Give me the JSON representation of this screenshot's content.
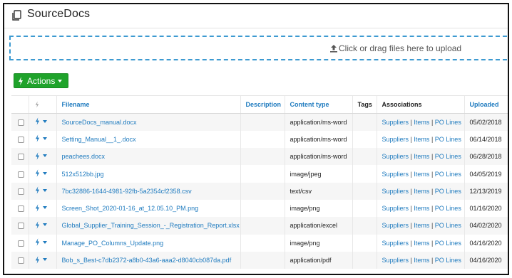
{
  "app": {
    "title": "SourceDocs"
  },
  "upload": {
    "text": "Click or drag files here to upload"
  },
  "actions": {
    "label": "Actions"
  },
  "table": {
    "columns": {
      "filename": "Filename",
      "description": "Description",
      "content_type": "Content type",
      "tags": "Tags",
      "associations": "Associations",
      "uploaded": "Uploaded"
    },
    "association_links": {
      "suppliers": "Suppliers",
      "items": "Items",
      "po_lines": "PO Lines",
      "separator": "|"
    },
    "rows": [
      {
        "filename": "SourceDocs_manual.docx",
        "description": "",
        "content_type": "application/ms-word",
        "tags": "",
        "uploaded": "05/02/2018"
      },
      {
        "filename": "Setting_Manual__1_.docx",
        "description": "",
        "content_type": "application/ms-word",
        "tags": "",
        "uploaded": "06/14/2018"
      },
      {
        "filename": "peachees.docx",
        "description": "",
        "content_type": "application/ms-word",
        "tags": "",
        "uploaded": "06/28/2018"
      },
      {
        "filename": "512x512bb.jpg",
        "description": "",
        "content_type": "image/jpeg",
        "tags": "",
        "uploaded": "04/05/2019"
      },
      {
        "filename": "7bc32886-1644-4981-92fb-5a2354cf2358.csv",
        "description": "",
        "content_type": "text/csv",
        "tags": "",
        "uploaded": "12/13/2019"
      },
      {
        "filename": "Screen_Shot_2020-01-16_at_12.05.10_PM.png",
        "description": "",
        "content_type": "image/png",
        "tags": "",
        "uploaded": "01/16/2020"
      },
      {
        "filename": "Global_Supplier_Training_Session_-_Registration_Report.xlsx",
        "description": "",
        "content_type": "application/excel",
        "tags": "",
        "uploaded": "04/02/2020"
      },
      {
        "filename": "Manage_PO_Columns_Update.png",
        "description": "",
        "content_type": "image/png",
        "tags": "",
        "uploaded": "04/16/2020"
      },
      {
        "filename": "Bob_s_Best-c7db2372-a8b0-43a6-aaa2-d8040cb087da.pdf",
        "description": "",
        "content_type": "application/pdf",
        "tags": "",
        "uploaded": "04/16/2020"
      }
    ]
  },
  "colors": {
    "accent": "#1f7bbf",
    "action_green": "#1fa32b",
    "dropzone_border": "#3d9ad1"
  },
  "icons": {
    "title": "copy-documents-icon",
    "upload": "upload-arrow-icon",
    "action": "bolt-icon",
    "caret": "caret-down-icon"
  }
}
